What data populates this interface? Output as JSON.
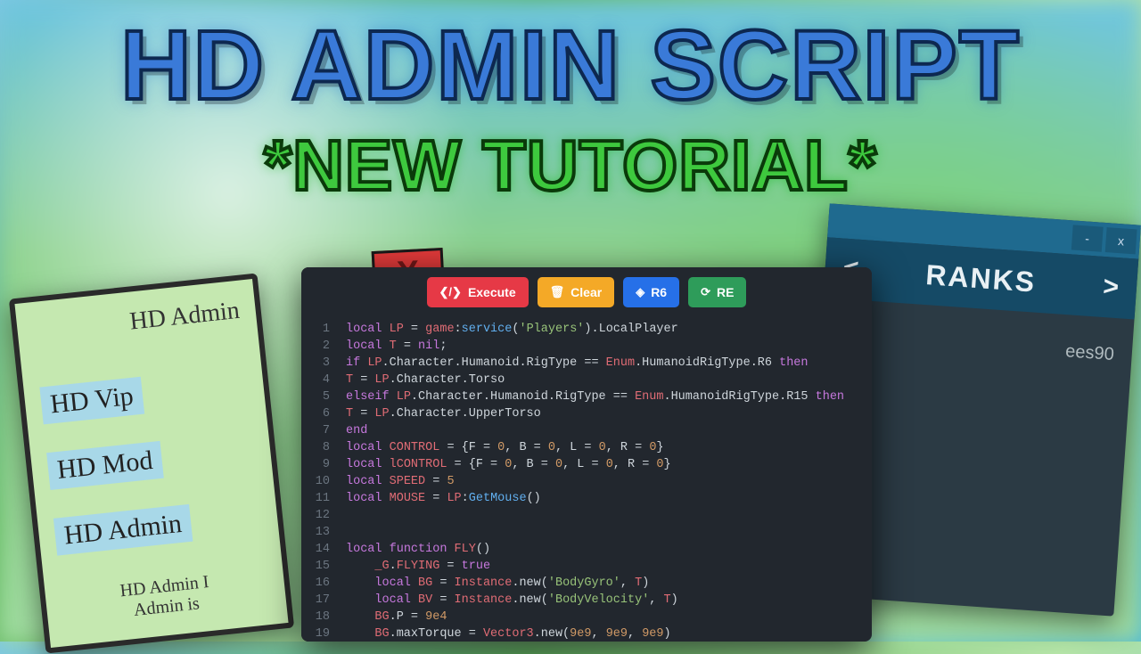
{
  "titles": {
    "main": "HD ADMIN SCRIPT",
    "sub": "*NEW TUTORIAL*"
  },
  "admin_panel": {
    "header": "HD Admin",
    "ranks": [
      "HD Vip",
      "HD Mod",
      "HD Admin"
    ],
    "footer_line1": "HD Admin I",
    "footer_line2": "Admin is"
  },
  "ranks_panel": {
    "window_buttons": {
      "min": "-",
      "close": "x"
    },
    "nav": {
      "prev": "<",
      "title": "RANKS",
      "next": ">"
    },
    "body_text": "ees90"
  },
  "red_close": {
    "label": "X"
  },
  "editor": {
    "toolbar": {
      "execute": "Execute",
      "clear": "Clear",
      "r6": "R6",
      "re": "RE"
    },
    "lines": [
      "local LP = game:service('Players').LocalPlayer",
      "local T = nil;",
      "if LP.Character.Humanoid.RigType == Enum.HumanoidRigType.R6 then",
      "T = LP.Character.Torso",
      "elseif LP.Character.Humanoid.RigType == Enum.HumanoidRigType.R15 then",
      "T = LP.Character.UpperTorso",
      "end",
      "local CONTROL = {F = 0, B = 0, L = 0, R = 0}",
      "local lCONTROL = {F = 0, B = 0, L = 0, R = 0}",
      "local SPEED = 5",
      "local MOUSE = LP:GetMouse()",
      "",
      "",
      "local function FLY()",
      "    _G.FLYING = true",
      "    local BG = Instance.new('BodyGyro', T)",
      "    local BV = Instance.new('BodyVelocity', T)",
      "    BG.P = 9e4",
      "    BG.maxTorque = Vector3.new(9e9, 9e9, 9e9)"
    ]
  }
}
